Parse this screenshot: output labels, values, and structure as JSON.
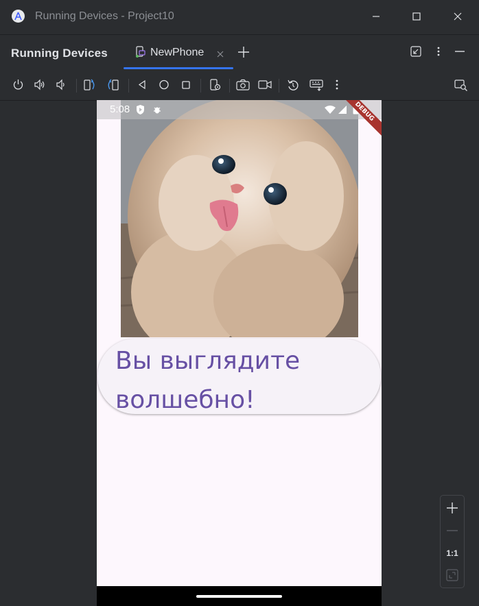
{
  "window": {
    "title": "Running Devices - Project10",
    "controls": [
      "minimize",
      "maximize",
      "close"
    ]
  },
  "tool_window": {
    "title": "Running Devices",
    "tabs": [
      {
        "label": "NewPhone",
        "active": true
      }
    ],
    "accent_color": "#3574f0"
  },
  "toolbar": {
    "icons": [
      "power-icon",
      "volume-up-icon",
      "volume-down-icon",
      "rotate-left-icon",
      "rotate-right-icon",
      "back-icon",
      "home-icon",
      "overview-icon",
      "device-settings-icon",
      "screenshot-icon",
      "screen-record-icon",
      "reset-icon",
      "keyboard-icon",
      "more-icon",
      "device-search-icon"
    ]
  },
  "device": {
    "status_time": "5:08",
    "debug_banner": "DEBUG",
    "message": "Вы выглядите волшебно!",
    "text_color": "#6750a4",
    "background": "#fdf7fd"
  },
  "zoom": {
    "ratio_label": "1:1"
  }
}
